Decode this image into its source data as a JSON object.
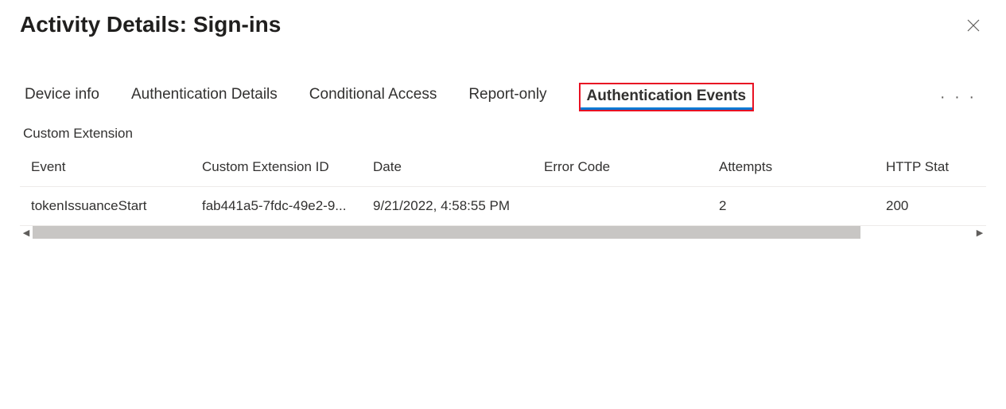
{
  "header": {
    "title": "Activity Details: Sign-ins"
  },
  "tabs": {
    "items": [
      {
        "label": "Device info"
      },
      {
        "label": "Authentication Details"
      },
      {
        "label": "Conditional Access"
      },
      {
        "label": "Report-only"
      },
      {
        "label": "Authentication Events"
      }
    ],
    "activeIndex": 4
  },
  "section": {
    "title": "Custom Extension"
  },
  "table": {
    "columns": [
      "Event",
      "Custom Extension ID",
      "Date",
      "Error Code",
      "Attempts",
      "HTTP Stat"
    ],
    "rows": [
      {
        "event": "tokenIssuanceStart",
        "custom_extension_id": "fab441a5-7fdc-49e2-9...",
        "date": "9/21/2022, 4:58:55 PM",
        "error_code": "",
        "attempts": "2",
        "http_stat": "200"
      }
    ]
  },
  "more": {
    "label": "· · ·"
  }
}
